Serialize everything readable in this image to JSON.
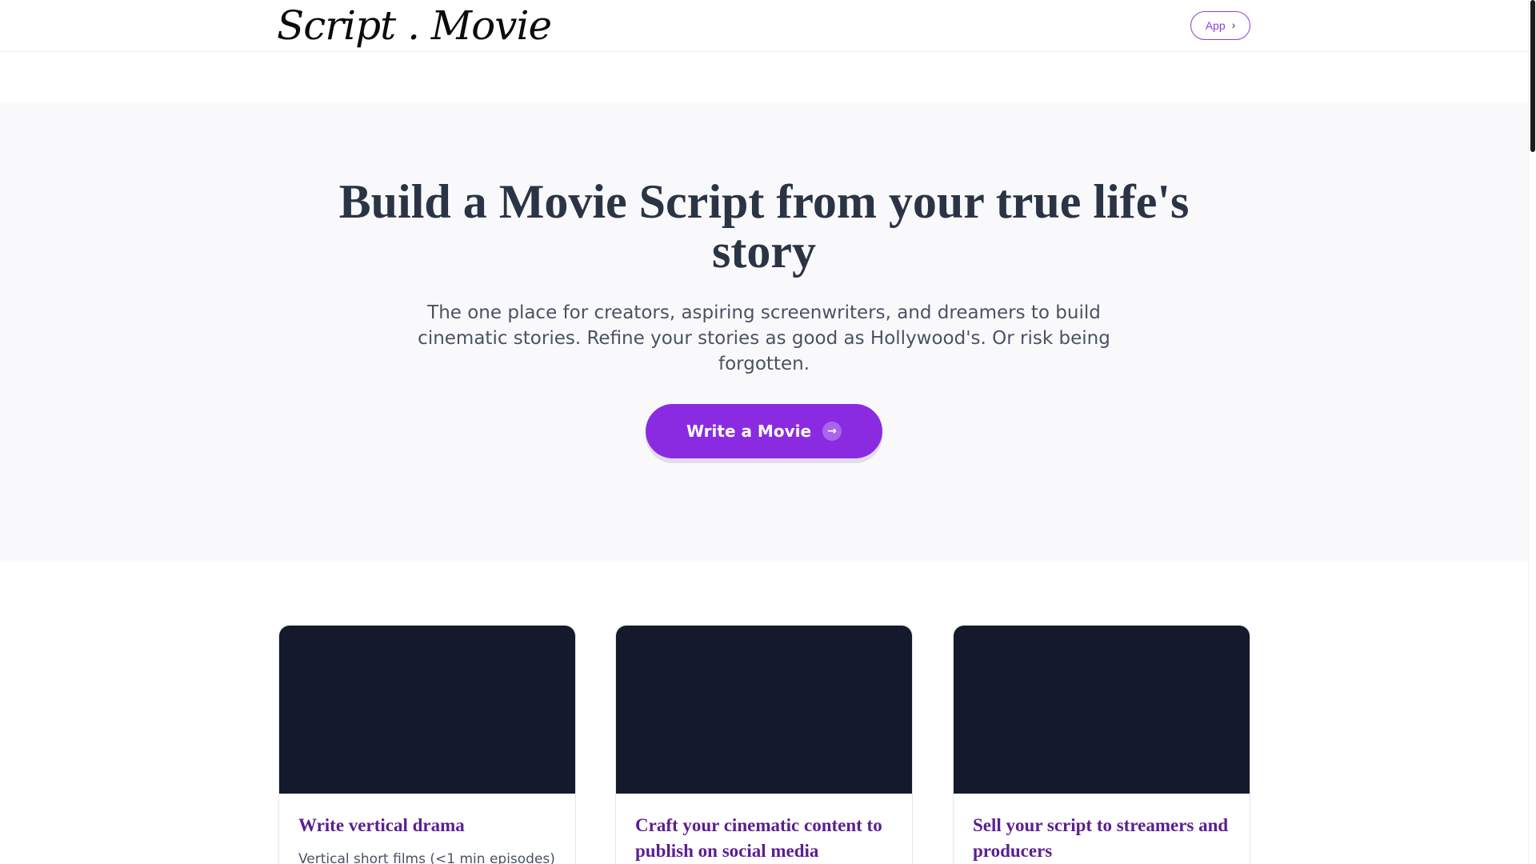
{
  "header": {
    "logo_text": "Script . Movie",
    "app_button_label": "App",
    "app_button_icon": "chevron-right-icon"
  },
  "hero": {
    "title": "Build a Movie Script from your true life's story",
    "subtitle": "The one place for creators, aspiring screenwriters, and dreamers to build cinematic stories. Refine your stories as good as Hollywood's. Or risk being forgotten.",
    "cta_label": "Write a Movie",
    "cta_icon": "arrow-right-icon"
  },
  "cards": [
    {
      "title": "Write vertical drama",
      "text": "Vertical short films (<1 min episodes)"
    },
    {
      "title": "Craft your cinematic content to publish on social media",
      "text": ""
    },
    {
      "title": "Sell your script to streamers and producers",
      "text": ""
    }
  ],
  "colors": {
    "accent": "#8a2be2",
    "card_title": "#5b1f8f",
    "card_media": "#141a2b",
    "hero_bg": "#f9f9fb",
    "heading": "#2b3445"
  }
}
